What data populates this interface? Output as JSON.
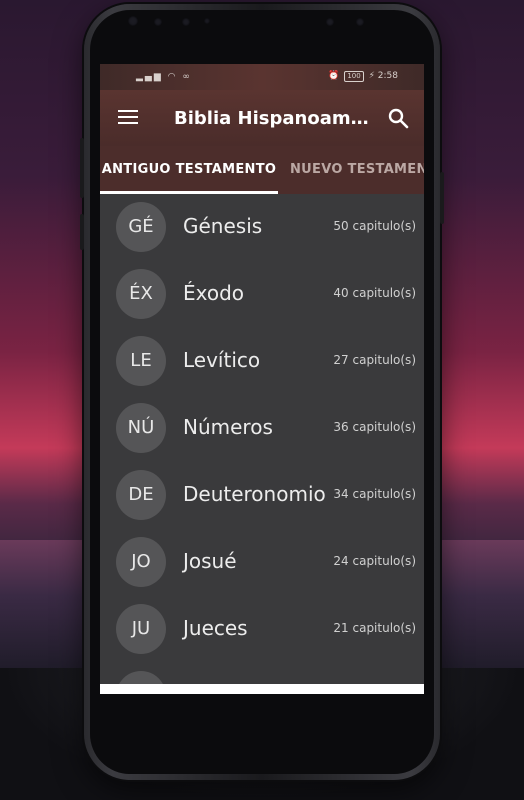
{
  "status_bar": {
    "left_icons": "signal wifi voicemail",
    "battery": "100",
    "time": "2:58"
  },
  "app_bar": {
    "title": "Biblia Hispanoamer..."
  },
  "tabs": [
    {
      "label": "ANTIGUO TESTAMENTO",
      "active": true
    },
    {
      "label": "NUEVO TESTAMENTO",
      "active": false
    }
  ],
  "books": [
    {
      "abbr": "GÉ",
      "name": "Génesis",
      "chapters": "50 capitulo(s)"
    },
    {
      "abbr": "ÉX",
      "name": "Éxodo",
      "chapters": "40 capitulo(s)"
    },
    {
      "abbr": "LE",
      "name": "Levítico",
      "chapters": "27 capitulo(s)"
    },
    {
      "abbr": "NÚ",
      "name": "Números",
      "chapters": "36 capitulo(s)"
    },
    {
      "abbr": "DE",
      "name": "Deuteronomio",
      "chapters": "34 capitulo(s)"
    },
    {
      "abbr": "JO",
      "name": "Josué",
      "chapters": "24 capitulo(s)"
    },
    {
      "abbr": "JU",
      "name": "Jueces",
      "chapters": "21 capitulo(s)"
    }
  ],
  "colors": {
    "app_bar": "#5a3430",
    "tab_bar": "#4c2d2b",
    "list_background": "#3a3a3c",
    "avatar": "#555557"
  }
}
